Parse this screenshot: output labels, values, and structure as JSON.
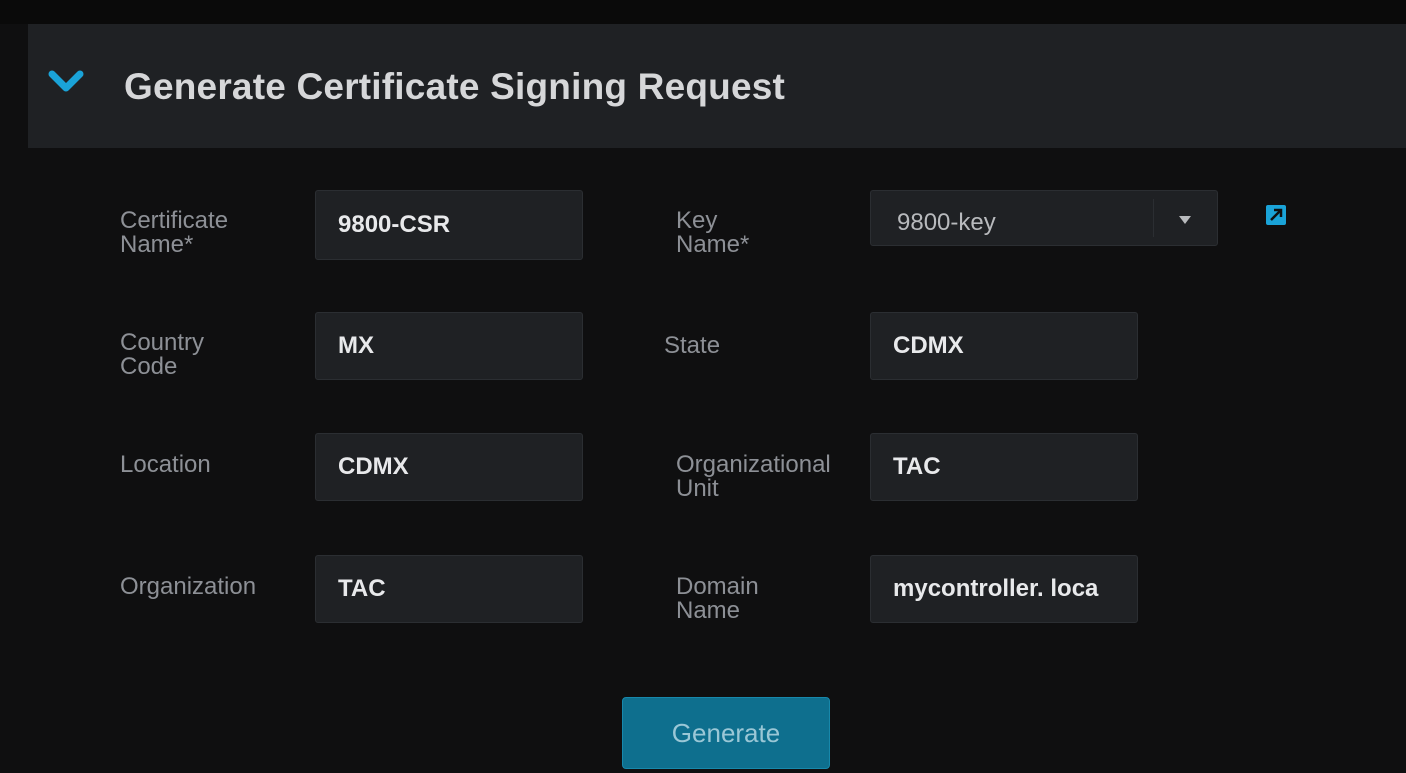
{
  "panel": {
    "title": "Generate Certificate Signing Request",
    "expand_icon": "chevron-down-icon",
    "accent_color": "#1aa3d8"
  },
  "form": {
    "certificate_name": {
      "label": "Certificate\nName*",
      "value": "9800-CSR"
    },
    "key_name": {
      "label": "Key\nName*",
      "value": "9800-key",
      "icon": "add-key-icon"
    },
    "country_code": {
      "label": "Country\nCode",
      "value": "MX"
    },
    "state": {
      "label": "State",
      "value": "CDMX"
    },
    "location": {
      "label": "Location",
      "value": "CDMX"
    },
    "organizational_unit": {
      "label": "Organizational\nUnit",
      "value": "TAC"
    },
    "organization": {
      "label": "Organization",
      "value": "TAC"
    },
    "domain_name": {
      "label": "Domain\nName",
      "value": "mycontroller. loca"
    }
  },
  "actions": {
    "generate_label": "Generate",
    "generate_color": "#0e6f8e"
  }
}
